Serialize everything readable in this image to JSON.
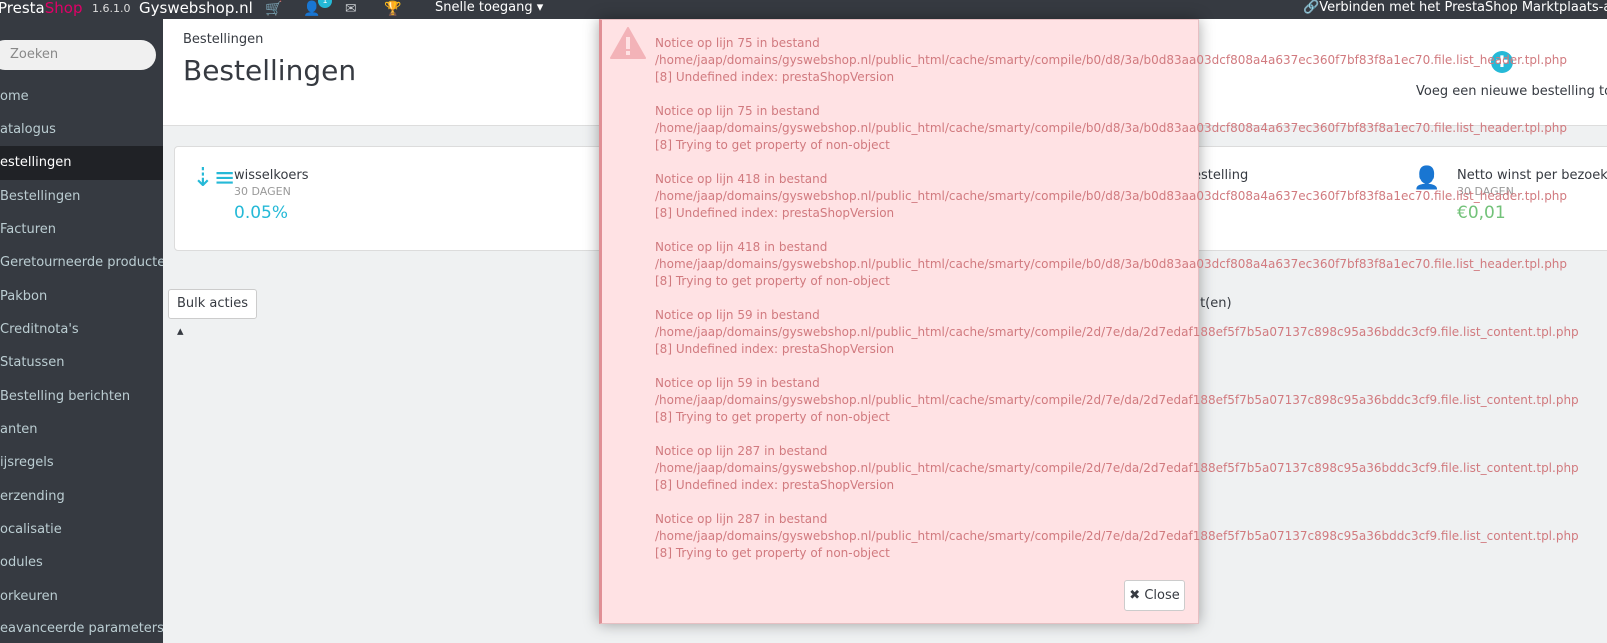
{
  "topbar": {
    "logo_part1": "Presta",
    "logo_part2": "Shop",
    "version": "1.6.1.0",
    "shop_name": "Gyswebshop.nl",
    "badge_count": "1",
    "quick_access": "Snelle toegang",
    "connect": "Verbinden met het PrestaShop Marktplaats-accoun"
  },
  "sidebar": {
    "search_placeholder": "Zoeken",
    "items": [
      {
        "label": "ome"
      },
      {
        "label": "atalogus"
      },
      {
        "label": "estellingen"
      },
      {
        "label": "Bestellingen"
      },
      {
        "label": "Facturen"
      },
      {
        "label": "Geretourneerde producten"
      },
      {
        "label": "Pakbon"
      },
      {
        "label": "Creditnota's"
      },
      {
        "label": "Statussen"
      },
      {
        "label": "Bestelling berichten"
      },
      {
        "label": "anten"
      },
      {
        "label": "ijsregels"
      },
      {
        "label": "erzending"
      },
      {
        "label": "ocalisatie"
      },
      {
        "label": "odules"
      },
      {
        "label": "orkeuren"
      },
      {
        "label": "eavanceerde parameters"
      }
    ]
  },
  "header": {
    "breadcrumb": "Bestellingen",
    "title": "Bestellingen",
    "add_order": "Voeg een nieuwe bestelling toe"
  },
  "kpis": {
    "k1_title": "wisselkoers",
    "k1_sub": "30 DAGEN",
    "k1_value": "0.05%",
    "k3_title": "estelling",
    "k4_title": "Netto winst per bezoeker",
    "k4_sub": "30 DAGEN",
    "k4_value": "€0,01"
  },
  "list": {
    "bulk_label": "Bulk acties",
    "count_text": ")t(en)"
  },
  "modal": {
    "notices": [
      {
        "line1": "Notice op lijn 75 in bestand",
        "line2": "/home/jaap/domains/gyswebshop.nl/public_html/cache/smarty/compile/b0/d8/3a/b0d83aa03dcf808a4a637ec360f7bf83f8a1ec70.file.list_header.tpl.php",
        "line3": "[8] Undefined index: prestaShopVersion"
      },
      {
        "line1": "Notice op lijn 75 in bestand",
        "line2": "/home/jaap/domains/gyswebshop.nl/public_html/cache/smarty/compile/b0/d8/3a/b0d83aa03dcf808a4a637ec360f7bf83f8a1ec70.file.list_header.tpl.php",
        "line3": "[8] Trying to get property of non-object"
      },
      {
        "line1": "Notice op lijn 418 in bestand",
        "line2": "/home/jaap/domains/gyswebshop.nl/public_html/cache/smarty/compile/b0/d8/3a/b0d83aa03dcf808a4a637ec360f7bf83f8a1ec70.file.list_header.tpl.php",
        "line3": "[8] Undefined index: prestaShopVersion"
      },
      {
        "line1": "Notice op lijn 418 in bestand",
        "line2": "/home/jaap/domains/gyswebshop.nl/public_html/cache/smarty/compile/b0/d8/3a/b0d83aa03dcf808a4a637ec360f7bf83f8a1ec70.file.list_header.tpl.php",
        "line3": "[8] Trying to get property of non-object"
      },
      {
        "line1": "Notice op lijn 59 in bestand",
        "line2": "/home/jaap/domains/gyswebshop.nl/public_html/cache/smarty/compile/2d/7e/da/2d7edaf188ef5f7b5a07137c898c95a36bddc3cf9.file.list_content.tpl.php",
        "line3": "[8] Undefined index: prestaShopVersion"
      },
      {
        "line1": "Notice op lijn 59 in bestand",
        "line2": "/home/jaap/domains/gyswebshop.nl/public_html/cache/smarty/compile/2d/7e/da/2d7edaf188ef5f7b5a07137c898c95a36bddc3cf9.file.list_content.tpl.php",
        "line3": "[8] Trying to get property of non-object"
      },
      {
        "line1": "Notice op lijn 287 in bestand",
        "line2": "/home/jaap/domains/gyswebshop.nl/public_html/cache/smarty/compile/2d/7e/da/2d7edaf188ef5f7b5a07137c898c95a36bddc3cf9.file.list_content.tpl.php",
        "line3": "[8] Undefined index: prestaShopVersion"
      },
      {
        "line1": "Notice op lijn 287 in bestand",
        "line2": "/home/jaap/domains/gyswebshop.nl/public_html/cache/smarty/compile/2d/7e/da/2d7edaf188ef5f7b5a07137c898c95a36bddc3cf9.file.list_content.tpl.php",
        "line3": "[8] Trying to get property of non-object"
      }
    ],
    "close_label": "Close"
  },
  "colors": {
    "accent": "#25b9d7",
    "brand_shop": "#df0067",
    "sidebar_bg": "#363a41",
    "modal_bg": "#ffe2e4",
    "notice_text": "#d17a7f",
    "kpi_green": "#72c279"
  }
}
